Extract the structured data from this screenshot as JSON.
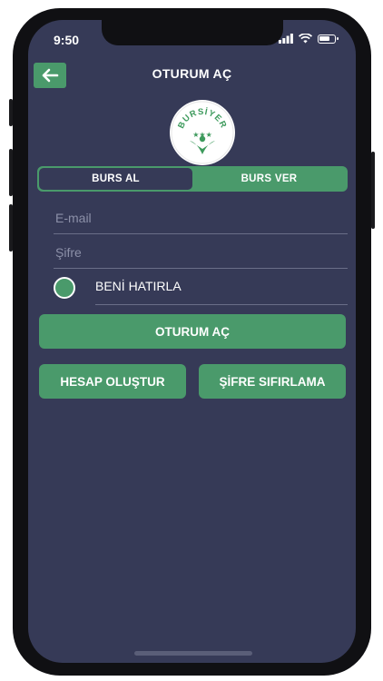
{
  "status_bar": {
    "time": "9:50"
  },
  "header": {
    "title": "OTURUM AÇ",
    "back_icon": "arrow-left-icon"
  },
  "logo": {
    "text": "BURSİYER",
    "icon": "bursiyer-logo"
  },
  "segmented_control": {
    "options": [
      {
        "label": "BURS AL",
        "active": true
      },
      {
        "label": "BURS VER",
        "active": false
      }
    ]
  },
  "form": {
    "email_placeholder": "E-mail",
    "password_placeholder": "Şifre",
    "remember_label": "BENİ HATIRLA"
  },
  "buttons": {
    "login": "OTURUM AÇ",
    "create_account": "HESAP OLUŞTUR",
    "reset_password": "ŞİFRE SIFIRLAMA"
  },
  "colors": {
    "background": "#363a57",
    "accent": "#4a9a6b",
    "text": "#ffffff",
    "placeholder": "#8c90a8"
  }
}
